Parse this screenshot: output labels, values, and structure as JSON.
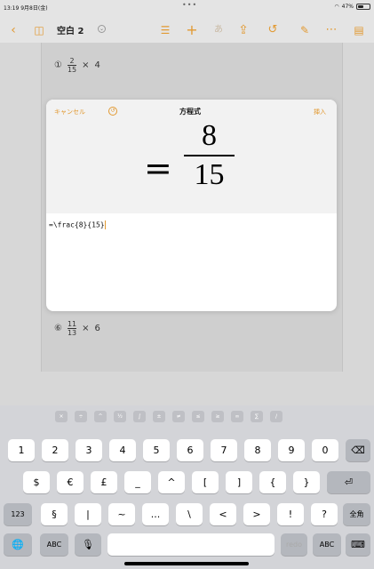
{
  "status": {
    "time": "13:19",
    "date": "9月8日(金)",
    "dots": "•••",
    "battery": "47%"
  },
  "toolbar": {
    "doc_title": "空白 2"
  },
  "document": {
    "problem_top": {
      "num": "①",
      "numer": "2",
      "denom": "15",
      "op": "×",
      "value": "4"
    },
    "problem_bottom": {
      "num": "⑥",
      "numer": "11",
      "denom": "13",
      "op": "×",
      "value": "6"
    }
  },
  "modal": {
    "cancel": "キャンセル",
    "title": "方程式",
    "insert": "挿入",
    "preview": {
      "equals": "=",
      "numerator": "8",
      "denominator": "15"
    },
    "latex": "=\\frac{8}{15}"
  },
  "keyboard": {
    "symbols": [
      "×",
      "÷",
      "^",
      "½",
      "∫",
      "±",
      "≠",
      "≤",
      "≥",
      "∞",
      "∑",
      "/"
    ],
    "row1": [
      "1",
      "2",
      "3",
      "4",
      "5",
      "6",
      "7",
      "8",
      "9",
      "0"
    ],
    "backspace": "⌫",
    "row2": [
      "$",
      "€",
      "£",
      "_",
      "^",
      "[",
      "]",
      "{",
      "}"
    ],
    "return": "⏎",
    "row3": [
      "§",
      "|",
      "~",
      "...",
      "\\",
      "<",
      ">",
      "!",
      "?"
    ],
    "key_123": "123",
    "key_zenkaku": "全角",
    "globe": "🌐",
    "abc_left": "ABC",
    "mic": "🎙",
    "redo": "redo",
    "abc_right": "ABC",
    "kbd": "⌨"
  },
  "colors": {
    "accent": "#e29a33"
  }
}
